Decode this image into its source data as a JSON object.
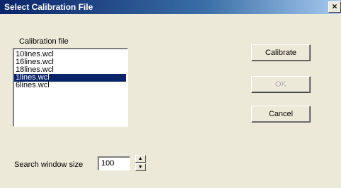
{
  "window": {
    "title": "Select Calibration File",
    "close_glyph": "×"
  },
  "calibration": {
    "label": "Calibration file",
    "files": [
      "10lines.wcl",
      "16lines.wcl",
      "18lines.wcl",
      "1lines.wcl",
      "6lines.wcl"
    ],
    "selected_index": 3
  },
  "buttons": {
    "calibrate": "Calibrate",
    "ok": "OK",
    "cancel": "Cancel"
  },
  "search_window": {
    "label": "Search window size",
    "value": "100",
    "up_glyph": "▲",
    "down_glyph": "▼"
  },
  "colors": {
    "selection": "#0a246a",
    "face": "#ece9d8",
    "title_gradient_start": "#0a246a"
  }
}
